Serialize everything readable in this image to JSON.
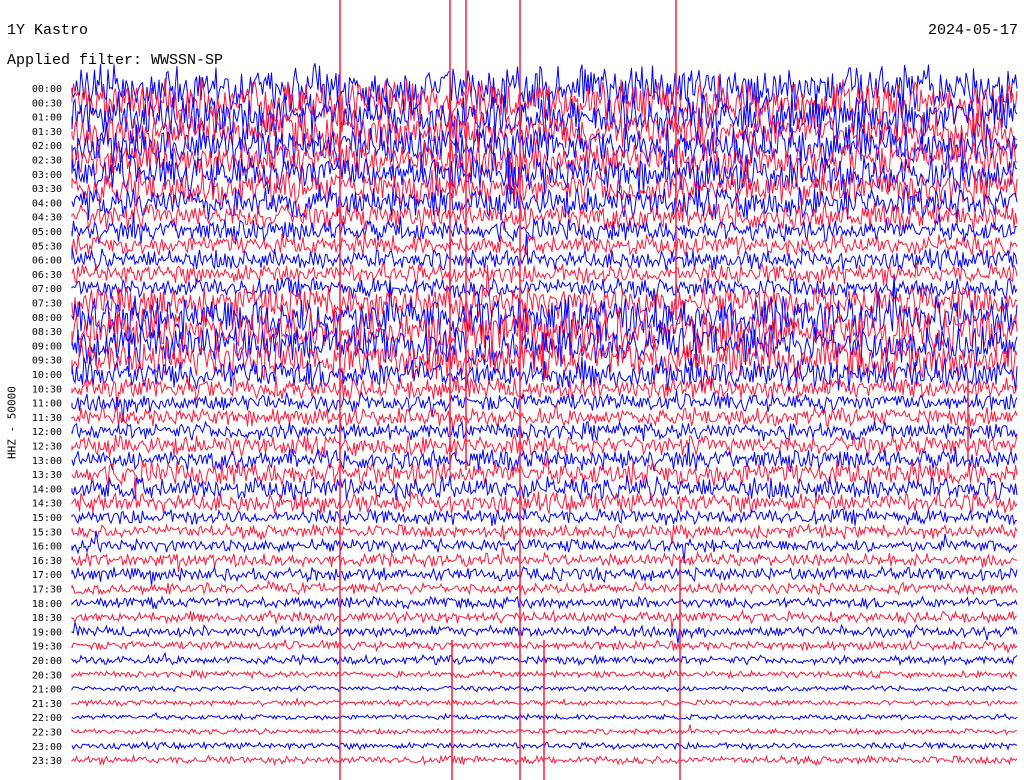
{
  "header": {
    "station": "1Y Kastro",
    "date": "2024-05-17",
    "filter": "Applied filter: WWSSN-SP"
  },
  "chart_data": {
    "type": "helicorder",
    "title": "1Y Kastro",
    "date": "2024-05-17",
    "filter": "WWSSN-SP",
    "ylabel": "HHZ - 50000",
    "row_labels": [
      "00:00",
      "00:30",
      "01:00",
      "01:30",
      "02:00",
      "02:30",
      "03:00",
      "03:30",
      "04:00",
      "04:30",
      "05:00",
      "05:30",
      "06:00",
      "06:30",
      "07:00",
      "07:30",
      "08:00",
      "08:30",
      "09:00",
      "09:30",
      "10:00",
      "10:30",
      "11:00",
      "11:30",
      "12:00",
      "12:30",
      "13:00",
      "13:30",
      "14:00",
      "14:30",
      "15:00",
      "15:30",
      "16:00",
      "16:30",
      "17:00",
      "17:30",
      "18:00",
      "18:30",
      "19:00",
      "19:30",
      "20:00",
      "20:30",
      "21:00",
      "21:30",
      "22:00",
      "22:30",
      "23:00",
      "23:30"
    ],
    "trace_colors": [
      "#0000ff",
      "#ff1a3c"
    ],
    "relative_amplitude": [
      1.0,
      0.95,
      0.95,
      0.9,
      0.9,
      0.85,
      0.85,
      0.75,
      0.7,
      0.6,
      0.5,
      0.45,
      0.45,
      0.45,
      0.45,
      0.75,
      0.95,
      0.95,
      0.9,
      0.85,
      0.7,
      0.5,
      0.4,
      0.4,
      0.4,
      0.45,
      0.45,
      0.55,
      0.5,
      0.45,
      0.35,
      0.3,
      0.3,
      0.3,
      0.3,
      0.25,
      0.25,
      0.25,
      0.25,
      0.2,
      0.2,
      0.15,
      0.12,
      0.12,
      0.12,
      0.12,
      0.15,
      0.18
    ]
  }
}
